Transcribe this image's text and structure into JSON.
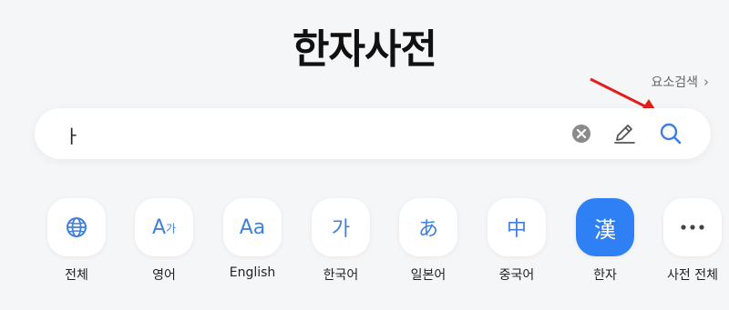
{
  "page_title": "한자사전",
  "element_search": {
    "label": "요소검색",
    "chevron": "›"
  },
  "search": {
    "value": "ㅏ"
  },
  "categories": [
    {
      "label": "전체",
      "icon": "globe-icon"
    },
    {
      "label": "영어",
      "icon_main": "A",
      "icon_sub": "가"
    },
    {
      "label": "English",
      "icon_text": "Aa"
    },
    {
      "label": "한국어",
      "icon_text": "가"
    },
    {
      "label": "일본어",
      "icon_text": "あ"
    },
    {
      "label": "중국어",
      "icon_text": "中"
    },
    {
      "label": "한자",
      "icon_text": "漢",
      "active": true
    },
    {
      "label": "사전 전체",
      "icon": "more-dots-icon"
    }
  ],
  "colors": {
    "accent": "#2f80f5",
    "icon": "#3f7fe0",
    "arrow": "#e0201c",
    "background": "#f5f6f8"
  }
}
